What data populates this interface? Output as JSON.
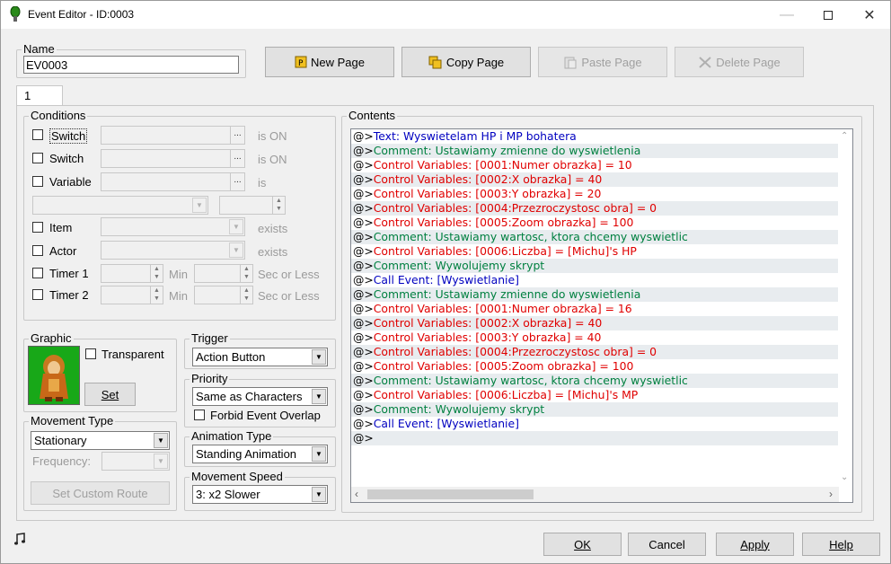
{
  "window": {
    "title": "Event Editor - ID:0003"
  },
  "name_group": {
    "label": "Name",
    "value": "EV0003"
  },
  "page_buttons": {
    "new_page": "New Page",
    "copy_page": "Copy Page",
    "paste_page": "Paste Page",
    "delete_page": "Delete Page"
  },
  "tabs": [
    "1"
  ],
  "conditions": {
    "label": "Conditions",
    "switch1": {
      "label": "Switch",
      "suffix": "is ON"
    },
    "switch2": {
      "label": "Switch",
      "suffix": "is ON"
    },
    "variable": {
      "label": "Variable",
      "suffix": "is"
    },
    "item": {
      "label": "Item",
      "suffix": "exists"
    },
    "actor": {
      "label": "Actor",
      "suffix": "exists"
    },
    "timer1": {
      "label": "Timer 1",
      "min": "Min",
      "sec": "Sec or Less"
    },
    "timer2": {
      "label": "Timer 2",
      "min": "Min",
      "sec": "Sec or Less"
    }
  },
  "graphic": {
    "label": "Graphic",
    "transparent": "Transparent",
    "set": "Set"
  },
  "trigger": {
    "label": "Trigger",
    "value": "Action Button"
  },
  "priority": {
    "label": "Priority",
    "value": "Same as Characters",
    "forbid": "Forbid Event Overlap"
  },
  "movement_type": {
    "label": "Movement Type",
    "value": "Stationary",
    "frequency": "Frequency:",
    "custom_route": "Set Custom Route"
  },
  "animation_type": {
    "label": "Animation Type",
    "value": "Standing Animation"
  },
  "movement_speed": {
    "label": "Movement Speed",
    "value": "3: x2 Slower"
  },
  "contents": {
    "label": "Contents",
    "rows": [
      {
        "prefix": "@>",
        "text": "Text: Wyswietelam HP i MP bohatera",
        "kind": "text"
      },
      {
        "prefix": "@>",
        "text": "Comment: Ustawiamy zmienne do wyswietlenia",
        "kind": "comment"
      },
      {
        "prefix": "@>",
        "text": "Control Variables: [0001:Numer obrazka] = 10",
        "kind": "var"
      },
      {
        "prefix": "@>",
        "text": "Control Variables: [0002:X obrazka] = 40",
        "kind": "var"
      },
      {
        "prefix": "@>",
        "text": "Control Variables: [0003:Y obrazka] = 20",
        "kind": "var"
      },
      {
        "prefix": "@>",
        "text": "Control Variables: [0004:Przezroczystosc obra] = 0",
        "kind": "var"
      },
      {
        "prefix": "@>",
        "text": "Control Variables: [0005:Zoom obrazka] = 100",
        "kind": "var"
      },
      {
        "prefix": "@>",
        "text": "Comment: Ustawiamy wartosc, ktora chcemy wyswietlic",
        "kind": "comment"
      },
      {
        "prefix": "@>",
        "text": "Control Variables: [0006:Liczba] = [Michu]'s HP",
        "kind": "var"
      },
      {
        "prefix": "@>",
        "text": "Comment: Wywolujemy skrypt",
        "kind": "comment"
      },
      {
        "prefix": "@>",
        "text": "Call Event: [Wyswietlanie]",
        "kind": "call"
      },
      {
        "prefix": "@>",
        "text": "Comment: Ustawiamy zmienne do wyswietlenia",
        "kind": "comment"
      },
      {
        "prefix": "@>",
        "text": "Control Variables: [0001:Numer obrazka] = 16",
        "kind": "var"
      },
      {
        "prefix": "@>",
        "text": "Control Variables: [0002:X obrazka] = 40",
        "kind": "var"
      },
      {
        "prefix": "@>",
        "text": "Control Variables: [0003:Y obrazka] = 40",
        "kind": "var"
      },
      {
        "prefix": "@>",
        "text": "Control Variables: [0004:Przezroczystosc obra] = 0",
        "kind": "var"
      },
      {
        "prefix": "@>",
        "text": "Control Variables: [0005:Zoom obrazka] = 100",
        "kind": "var"
      },
      {
        "prefix": "@>",
        "text": "Comment: Ustawiamy wartosc, ktora chcemy wyswietlic",
        "kind": "comment"
      },
      {
        "prefix": "@>",
        "text": "Control Variables: [0006:Liczba] = [Michu]'s MP",
        "kind": "var"
      },
      {
        "prefix": "@>",
        "text": "Comment: Wywolujemy skrypt",
        "kind": "comment"
      },
      {
        "prefix": "@>",
        "text": "Call Event: [Wyswietlanie]",
        "kind": "call"
      },
      {
        "prefix": "@>",
        "text": "",
        "kind": "empty"
      }
    ]
  },
  "footer": {
    "ok": "OK",
    "cancel": "Cancel",
    "apply": "Apply",
    "help": "Help"
  },
  "colors": {
    "text": "#0000c0",
    "comment": "#008040",
    "var": "#e00000",
    "call": "#0000c0",
    "row_alt": "#e8ecef"
  }
}
